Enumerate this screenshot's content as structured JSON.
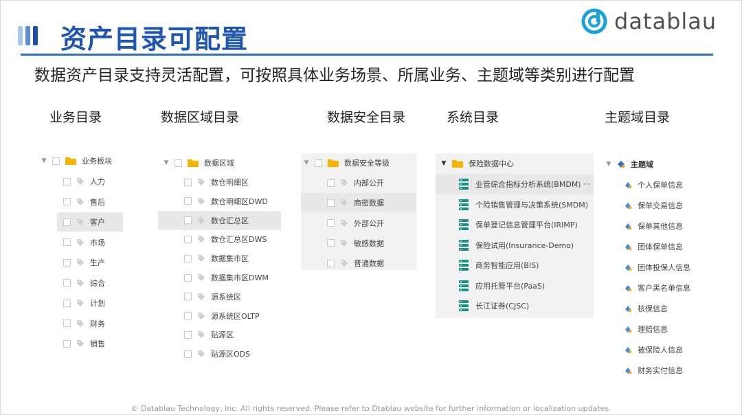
{
  "header": {
    "title": "资产目录可配置",
    "logo_text": "datablau",
    "subtitle": "数据资产目录支持灵活配置，可按照具体业务场景、所属业务、主题域等类别进行配置"
  },
  "colors": {
    "accent": "#1f56b0",
    "rule": "#2c6fc4",
    "folder": "#f5b400",
    "db_icon": "#1a8f86",
    "highlight": "#e8e8e8"
  },
  "columns": [
    {
      "heading": "业务目录"
    },
    {
      "heading": "数据区域目录"
    },
    {
      "heading": "数据安全目录"
    },
    {
      "heading": "系统目录"
    },
    {
      "heading": "主题域目录"
    }
  ],
  "business_tree": {
    "root": "业务板块",
    "items": [
      "人力",
      "售后",
      "客户",
      "市场",
      "生产",
      "综合",
      "计划",
      "财务",
      "销售"
    ],
    "selected_index": 2
  },
  "region_tree": {
    "root": "数据区域",
    "items": [
      "数仓明细区",
      "数仓明细区DWD",
      "数仓汇总区",
      "数仓汇总区DWS",
      "数据集市区",
      "数据集市区DWM",
      "源系统区",
      "源系统区OLTP",
      "贴源区",
      "贴源区ODS"
    ],
    "selected_index": 2
  },
  "security_tree": {
    "root": "数据安全等级",
    "items": [
      "内部公开",
      "商密数据",
      "外部公开",
      "敏感数据",
      "普通数据"
    ],
    "selected_index": 1
  },
  "system_tree": {
    "root": "保险数据中心",
    "items": [
      "业管综合指标分析系统(BMDM)",
      "个险销售管理与决策系统(SMDM)",
      "保单登记信息管理平台(IRIMP)",
      "保险试用(Insurance-Demo)",
      "商务智能应用(BIS)",
      "应用托管平台(PaaS)",
      "长江证券(CJSC)"
    ],
    "selected_index": 0,
    "more_label": "···"
  },
  "topic_tree": {
    "root": "主题域",
    "items": [
      "个人保单信息",
      "保单交易信息",
      "保单其他信息",
      "团体保单信息",
      "团体投保人信息",
      "客户黑名单信息",
      "核保信息",
      "理赔信息",
      "被保险人信息",
      "财务实付信息"
    ]
  },
  "footer": {
    "text": "© Datablau Technology, Inc. All rights reserved.  Please refer to Dtablau website for further information or localization updates."
  }
}
